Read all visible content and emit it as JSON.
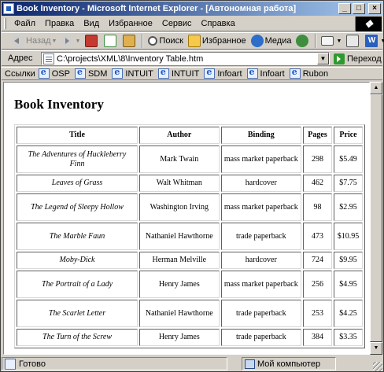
{
  "window": {
    "title": "Book Inventory - Microsoft Internet Explorer - [Автономная работа]",
    "controls": {
      "minimize": "_",
      "maximize": "□",
      "close": "×"
    }
  },
  "menu": [
    "Файл",
    "Правка",
    "Вид",
    "Избранное",
    "Сервис",
    "Справка"
  ],
  "toolbar": {
    "back": "Назад",
    "search": "Поиск",
    "favorites": "Избранное",
    "media": "Медиа"
  },
  "address": {
    "label": "Адрес",
    "url": "C:\\projects\\XML\\8\\Inventory Table.htm",
    "go": "Переход"
  },
  "links": {
    "label": "Ссылки",
    "items": [
      "OSP",
      "SDM",
      "INTUIT",
      "INTUIT",
      "Infoart",
      "Infoart",
      "Rubon"
    ]
  },
  "page": {
    "title": "Book Inventory",
    "columns": [
      "Title",
      "Author",
      "Binding",
      "Pages",
      "Price"
    ],
    "rows": [
      {
        "title": "The Adventures of Huckleberry Finn",
        "author": "Mark Twain",
        "binding": "mass market paperback",
        "pages": "298",
        "price": "$5.49"
      },
      {
        "title": "Leaves of Grass",
        "author": "Walt Whitman",
        "binding": "hardcover",
        "pages": "462",
        "price": "$7.75"
      },
      {
        "title": "The Legend of Sleepy Hollow",
        "author": "Washington Irving",
        "binding": "mass market paperback",
        "pages": "98",
        "price": "$2.95"
      },
      {
        "title": "The Marble Faun",
        "author": "Nathaniel Hawthorne",
        "binding": "trade paperback",
        "pages": "473",
        "price": "$10.95"
      },
      {
        "title": "Moby-Dick",
        "author": "Herman Melville",
        "binding": "hardcover",
        "pages": "724",
        "price": "$9.95"
      },
      {
        "title": "The Portrait of a Lady",
        "author": "Henry James",
        "binding": "mass market paperback",
        "pages": "256",
        "price": "$4.95"
      },
      {
        "title": "The Scarlet Letter",
        "author": "Nathaniel Hawthorne",
        "binding": "trade paperback",
        "pages": "253",
        "price": "$4.25"
      },
      {
        "title": "The Turn of the Screw",
        "author": "Henry James",
        "binding": "trade paperback",
        "pages": "384",
        "price": "$3.35"
      }
    ]
  },
  "status": {
    "text": "Готово",
    "zone": "Мой компьютер"
  }
}
